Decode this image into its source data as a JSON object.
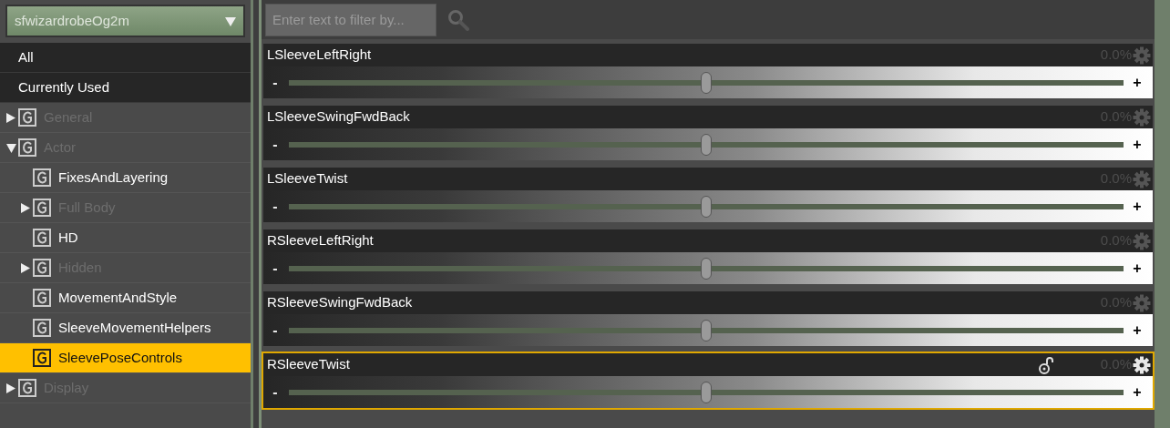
{
  "sidebar": {
    "dropdown": {
      "value": "sfwizardrobeOg2m"
    },
    "filters": [
      {
        "label": "All"
      },
      {
        "label": "Currently Used"
      }
    ],
    "tree": [
      {
        "label": "General",
        "dimmed": true,
        "expanded": false,
        "selected": false
      },
      {
        "label": "Actor",
        "dimmed": true,
        "expanded": true,
        "selected": false,
        "children": [
          {
            "label": "FixesAndLayering",
            "dimmed": false,
            "selected": false
          },
          {
            "label": "Full Body",
            "dimmed": true,
            "expanded": false,
            "selected": false
          },
          {
            "label": "HD",
            "dimmed": false,
            "selected": false
          },
          {
            "label": "Hidden",
            "dimmed": true,
            "expanded": false,
            "selected": false
          },
          {
            "label": "MovementAndStyle",
            "dimmed": false,
            "selected": false
          },
          {
            "label": "SleeveMovementHelpers",
            "dimmed": false,
            "selected": false
          },
          {
            "label": "SleevePoseControls",
            "dimmed": false,
            "selected": true
          }
        ]
      },
      {
        "label": "Display",
        "dimmed": true,
        "expanded": false,
        "selected": false
      }
    ]
  },
  "filter": {
    "placeholder": "Enter text to filter by..."
  },
  "properties": [
    {
      "name": "LSleeveLeftRight",
      "value": "0.0%",
      "level": 0.5,
      "selected": false,
      "decrement": "-",
      "increment": "+"
    },
    {
      "name": "LSleeveSwingFwdBack",
      "value": "0.0%",
      "level": 0.5,
      "selected": false,
      "decrement": "-",
      "increment": "+"
    },
    {
      "name": "LSleeveTwist",
      "value": "0.0%",
      "level": 0.5,
      "selected": false,
      "decrement": "-",
      "increment": "+"
    },
    {
      "name": "RSleeveLeftRight",
      "value": "0.0%",
      "level": 0.5,
      "selected": false,
      "decrement": "-",
      "increment": "+"
    },
    {
      "name": "RSleeveSwingFwdBack",
      "value": "0.0%",
      "level": 0.5,
      "selected": false,
      "decrement": "-",
      "increment": "+"
    },
    {
      "name": "RSleeveTwist",
      "value": "0.0%",
      "level": 0.5,
      "selected": true,
      "decrement": "-",
      "increment": "+"
    }
  ]
}
